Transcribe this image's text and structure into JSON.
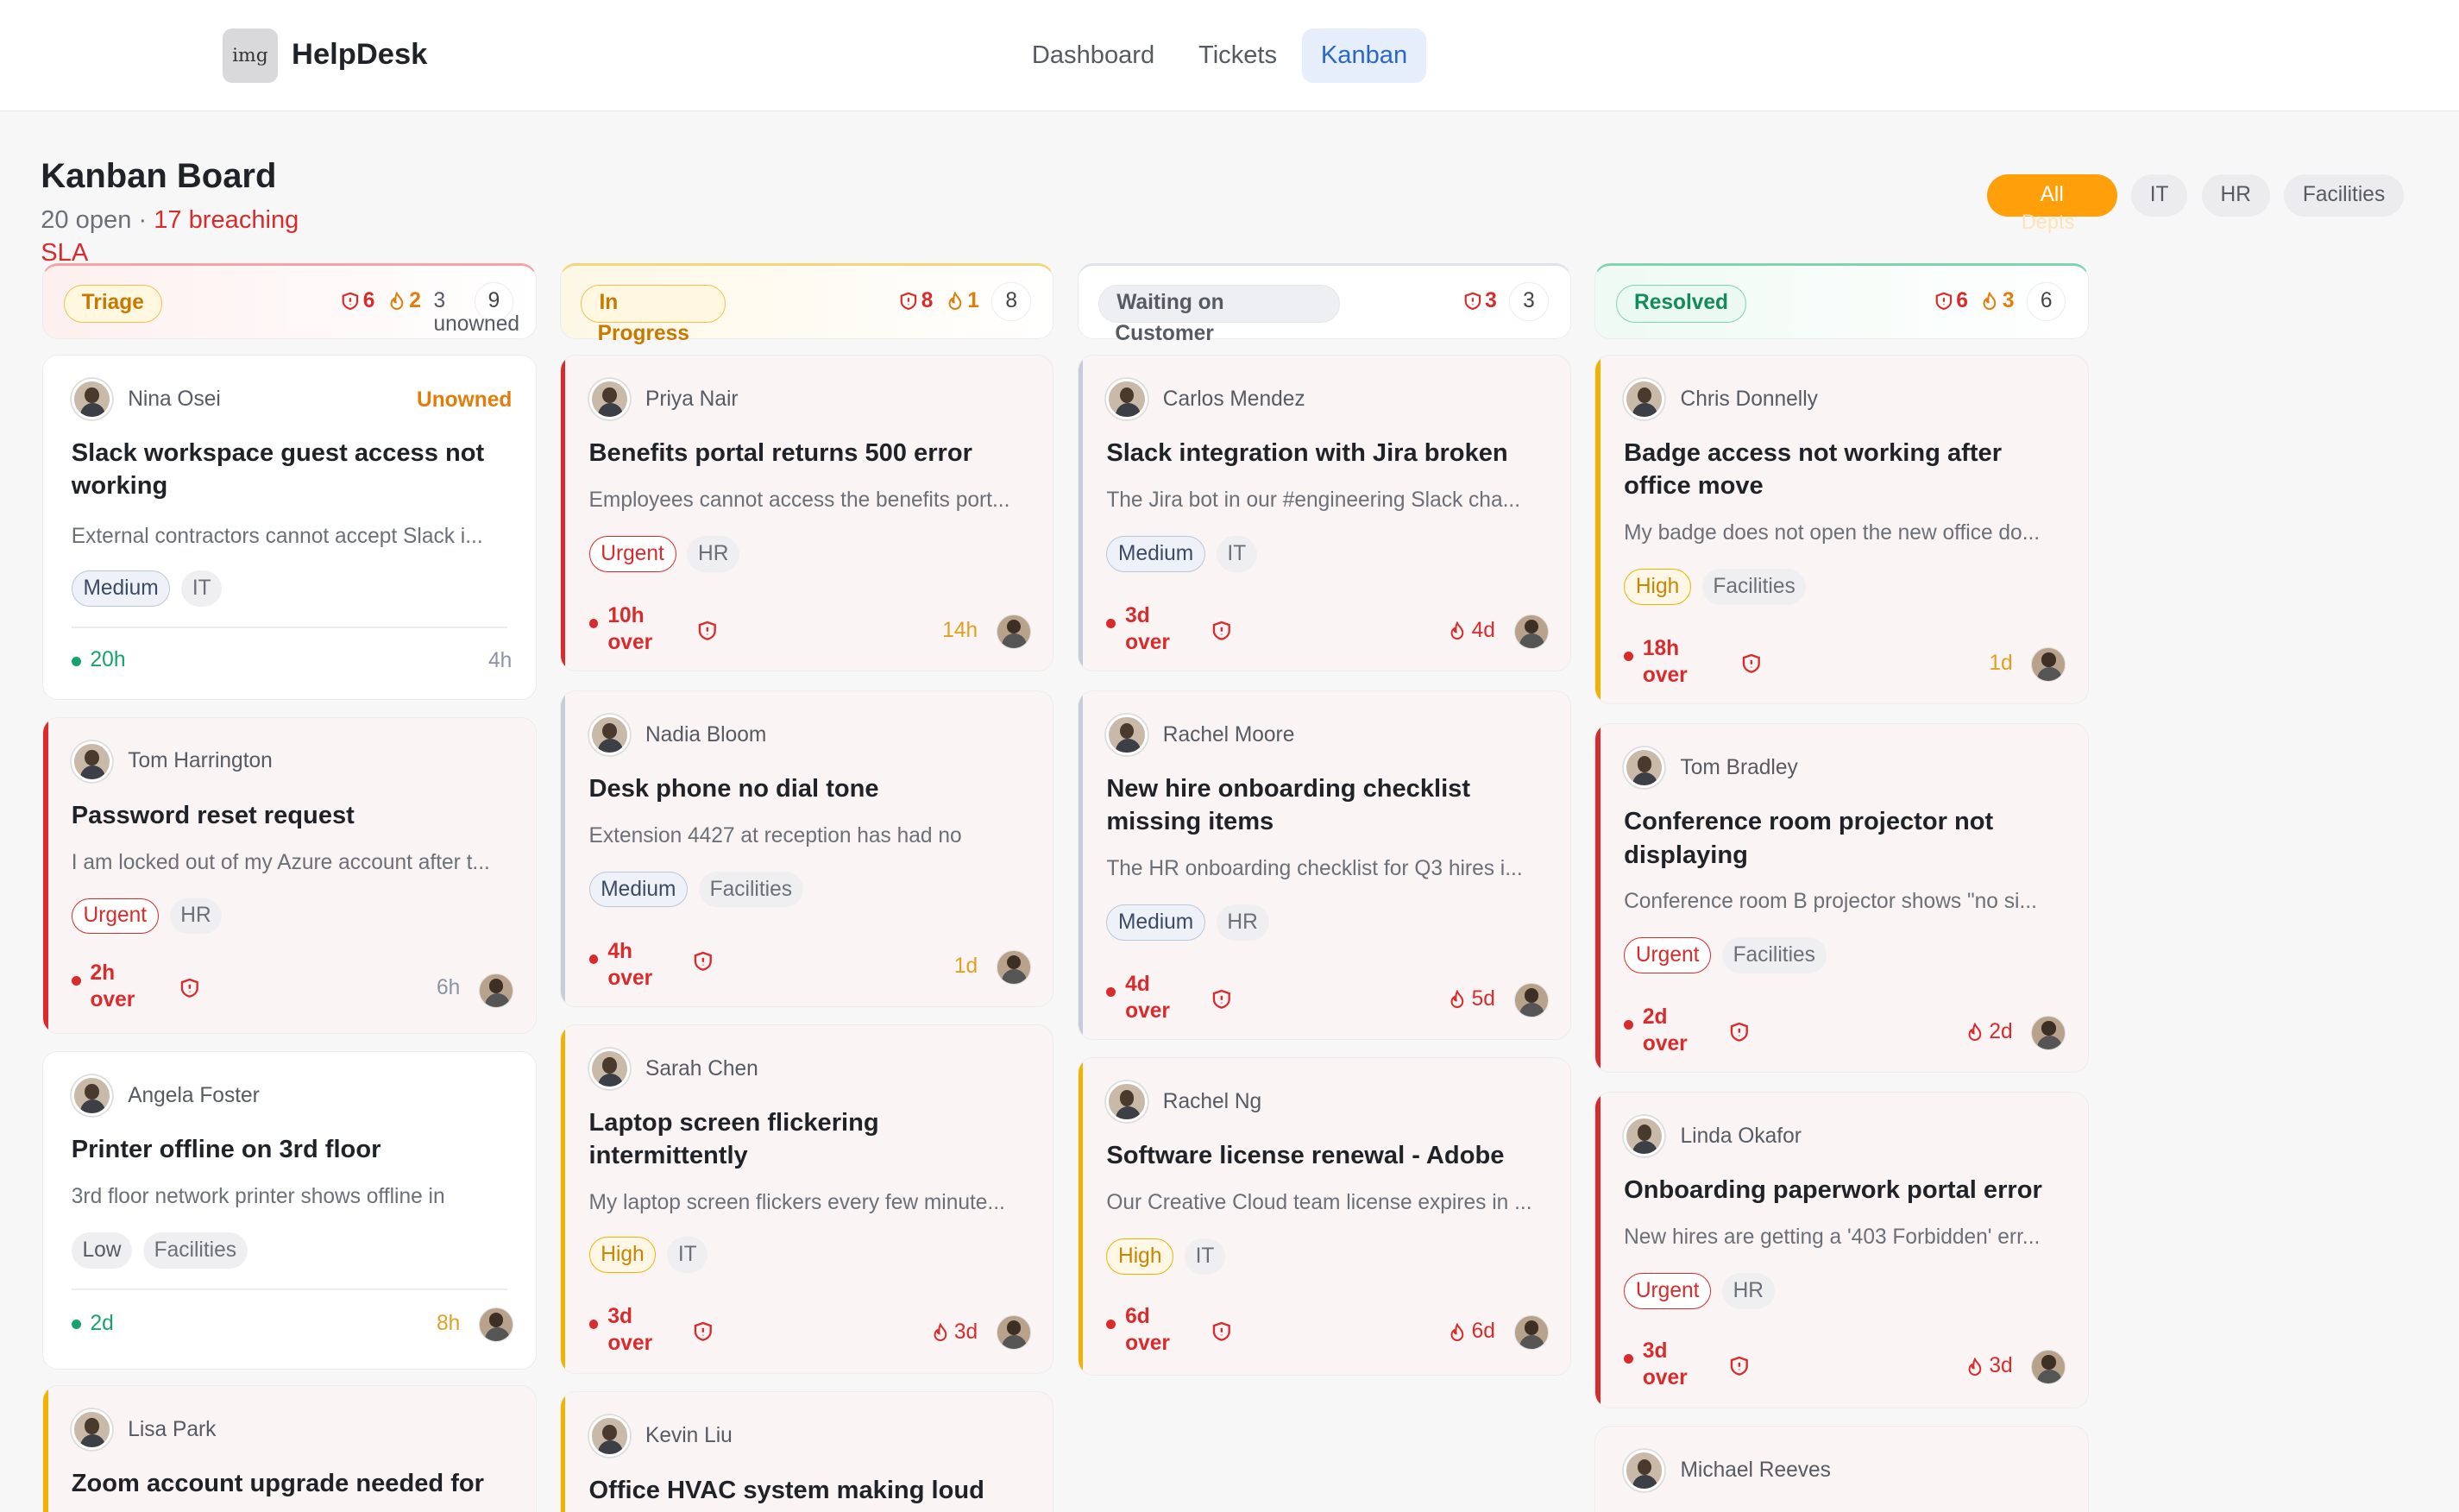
{
  "app": {
    "logo_text": "img",
    "name": "HelpDesk"
  },
  "nav": [
    {
      "label": "Dashboard",
      "active": false
    },
    {
      "label": "Tickets",
      "active": false
    },
    {
      "label": "Kanban",
      "active": true
    }
  ],
  "page": {
    "title": "Kanban Board",
    "open_text": "20 open · ",
    "breach_text": "17 breaching",
    "sla_text": "SLA"
  },
  "filters": {
    "all": "All",
    "all_sub": "Depts",
    "it": "IT",
    "hr": "HR",
    "facilities": "Facilities"
  },
  "colors": {
    "accent": "#ff9f0a",
    "urgent": "#d92b2b",
    "high": "#f0b300",
    "ok": "#16a36b",
    "link": "#2b67c9"
  },
  "columns": [
    {
      "label": "Triage",
      "label2": "",
      "breach": "6",
      "warn": "2",
      "unowned": "3",
      "unowned2": "unowned",
      "count": "9"
    },
    {
      "label": "In",
      "label2": "Progress",
      "breach": "8",
      "warn": "1",
      "count": "8"
    },
    {
      "label": "Waiting on",
      "label2": "Customer",
      "breach": "3",
      "count": "3"
    },
    {
      "label": "Resolved",
      "label2": "",
      "breach": "6",
      "warn": "3",
      "count": "6"
    }
  ],
  "cards": {
    "c0_0": {
      "person": "Nina Osei",
      "unowned": "Unowned",
      "title": "Slack workspace guest access not working",
      "desc": "External contractors cannot accept Slack i...",
      "prio": "Medium",
      "dept": "IT",
      "sla": "20h",
      "age": "4h"
    },
    "c0_1": {
      "person": "Tom Harrington",
      "title": "Password reset request",
      "desc": "I am locked out of my Azure account after t...",
      "prio": "Urgent",
      "dept": "HR",
      "sla1": "2h",
      "sla2": "over",
      "age": "6h"
    },
    "c0_2": {
      "person": "Angela Foster",
      "title": "Printer offline on 3rd floor",
      "desc": "3rd floor network printer shows offline in",
      "prio": "Low",
      "dept": "Facilities",
      "sla": "2d",
      "age": "8h"
    },
    "c0_3": {
      "person": "Lisa Park",
      "title": "Zoom account upgrade needed for"
    },
    "c1_0": {
      "person": "Priya Nair",
      "title": "Benefits portal returns 500 error",
      "desc": "Employees cannot access the benefits port...",
      "prio": "Urgent",
      "dept": "HR",
      "sla1": "10h",
      "sla2": "over",
      "age": "14h"
    },
    "c1_1": {
      "person": "Nadia Bloom",
      "title": "Desk phone no dial tone",
      "desc": "Extension 4427 at reception has had no",
      "prio": "Medium",
      "dept": "Facilities",
      "sla1": "4h",
      "sla2": "over",
      "age": "1d"
    },
    "c1_2": {
      "person": "Sarah Chen",
      "title": "Laptop screen flickering intermittently",
      "desc": "My laptop screen flickers every few minute...",
      "prio": "High",
      "dept": "IT",
      "sla1": "3d",
      "sla2": "over",
      "age": "3d"
    },
    "c1_3": {
      "person": "Kevin Liu",
      "title": "Office HVAC system making loud"
    },
    "c2_0": {
      "person": "Carlos Mendez",
      "title": "Slack integration with Jira broken",
      "desc": "The Jira bot in our #engineering Slack cha...",
      "prio": "Medium",
      "dept": "IT",
      "sla1": "3d",
      "sla2": "over",
      "age": "4d"
    },
    "c2_1": {
      "person": "Rachel Moore",
      "title": "New hire onboarding checklist missing items",
      "desc": "The HR onboarding checklist for Q3 hires i...",
      "prio": "Medium",
      "dept": "HR",
      "sla1": "4d",
      "sla2": "over",
      "age": "5d"
    },
    "c2_2": {
      "person": "Rachel Ng",
      "title": "Software license renewal - Adobe",
      "desc": "Our Creative Cloud team license expires in ...",
      "prio": "High",
      "dept": "IT",
      "sla1": "6d",
      "sla2": "over",
      "age": "6d"
    },
    "c3_0": {
      "person": "Chris Donnelly",
      "title": "Badge access not working after office move",
      "desc": "My badge does not open the new office do...",
      "prio": "High",
      "dept": "Facilities",
      "sla1": "18h",
      "sla2": "over",
      "age": "1d"
    },
    "c3_1": {
      "person": "Tom Bradley",
      "title": "Conference room projector not displaying",
      "desc": "Conference room B projector shows \"no si...",
      "prio": "Urgent",
      "dept": "Facilities",
      "sla1": "2d",
      "sla2": "over",
      "age": "2d"
    },
    "c3_2": {
      "person": "Linda Okafor",
      "title": "Onboarding paperwork portal error",
      "desc": "New hires are getting a '403 Forbidden' err...",
      "prio": "Urgent",
      "dept": "HR",
      "sla1": "3d",
      "sla2": "over",
      "age": "3d"
    },
    "c3_3": {
      "person": "Michael Reeves"
    }
  }
}
